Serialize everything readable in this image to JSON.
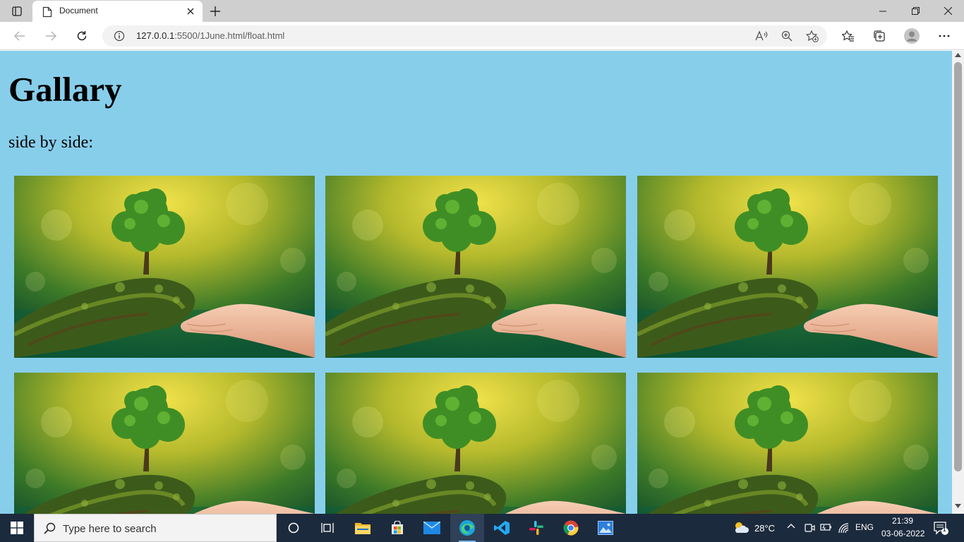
{
  "browser": {
    "tab_title": "Document",
    "url_host": "127.0.0.1",
    "url_path": ":5500/1June.html/float.html"
  },
  "page": {
    "heading": "Gallary",
    "subtitle": "side by side:",
    "images": [
      {
        "name": "gallery-image-1"
      },
      {
        "name": "gallery-image-2"
      },
      {
        "name": "gallery-image-3"
      },
      {
        "name": "gallery-image-4"
      },
      {
        "name": "gallery-image-5"
      },
      {
        "name": "gallery-image-6"
      }
    ]
  },
  "taskbar": {
    "search_placeholder": "Type here to search",
    "weather": "28°C",
    "language": "ENG",
    "time": "21:39",
    "date": "03-06-2022",
    "notification_count": "1"
  },
  "colors": {
    "page_background": "#87ceeb",
    "taskbar": "#1c2a3d"
  }
}
